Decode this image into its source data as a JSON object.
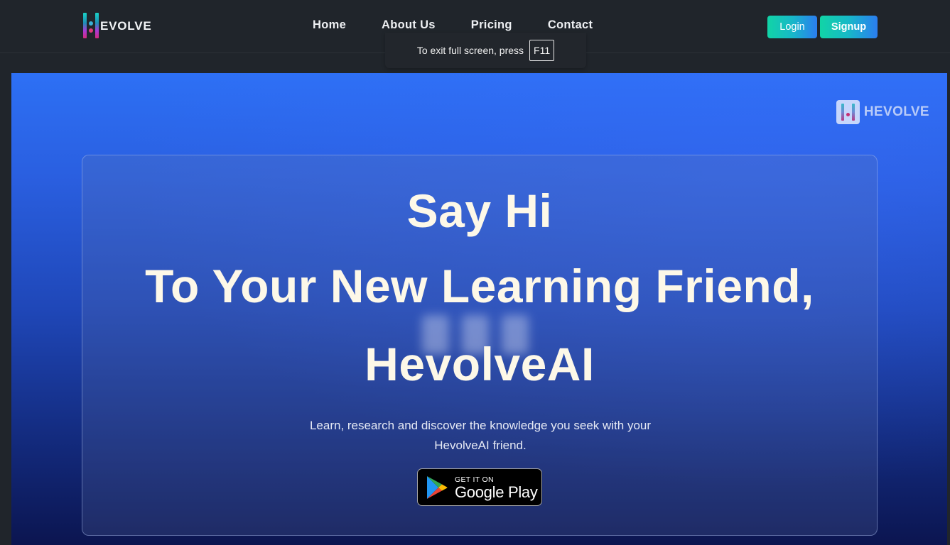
{
  "navbar": {
    "brand": {
      "text": "EVOLVE",
      "logo_icon": "hevolve-logo-icon"
    },
    "links": [
      {
        "label": "Home"
      },
      {
        "label": "About Us"
      },
      {
        "label": "Pricing"
      },
      {
        "label": "Contact"
      }
    ],
    "login_label": "Login",
    "signup_label": "Signup"
  },
  "fullscreen_toast": {
    "text": "To exit full screen, press",
    "key": "F11"
  },
  "hero": {
    "badge_text": "HEVOLVE",
    "headline_line1": "Say Hi",
    "headline_line2": "To Your New Learning Friend,",
    "headline_line3": "HevolveAI",
    "subtext": "Learn, research and discover the knowledge you seek with your HevolveAI friend.",
    "store_badge": {
      "small": "GET IT ON",
      "big": "Google Play",
      "icon": "google-play-icon"
    }
  },
  "colors": {
    "nav_bg": "#20252b",
    "button_gradient_start": "#11d4a6",
    "button_gradient_end": "#2b7df0",
    "hero_top": "#2d70f5",
    "hero_bottom": "#0b1550",
    "headline_text": "#fdf8e8"
  }
}
